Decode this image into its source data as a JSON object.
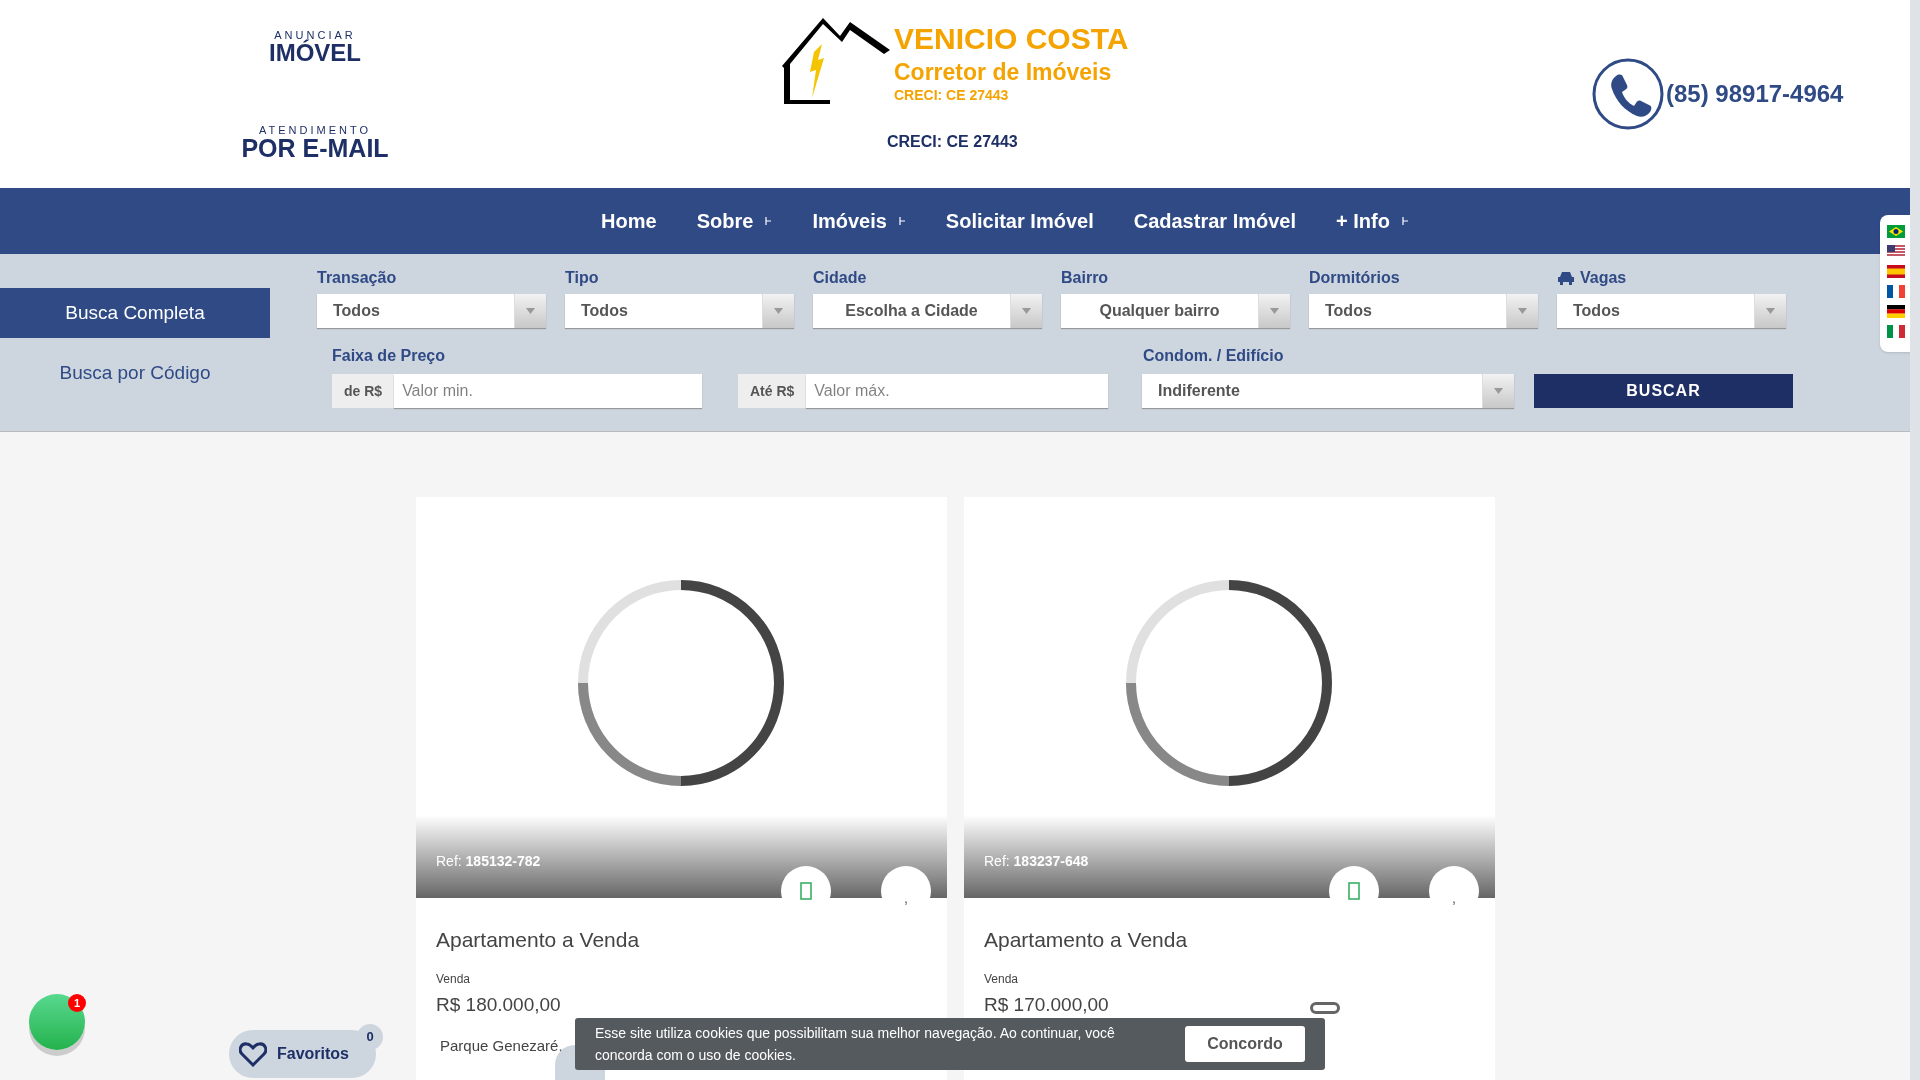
{
  "header": {
    "ad_link": {
      "small": "ANUNCIAR",
      "big": "IMÓVEL"
    },
    "email_link": {
      "small": "ATENDIMENTO",
      "big": "POR E-MAIL"
    },
    "logo": {
      "name": "VENICIO COSTA",
      "tagline": "Corretor de Imóveis",
      "creci": "CRECI: CE 27443"
    },
    "creci": "CRECI: CE 27443",
    "phone": "(85) 98917-4964"
  },
  "nav": [
    {
      "label": "Home",
      "dropdown": false
    },
    {
      "label": "Sobre",
      "dropdown": true
    },
    {
      "label": "Imóveis",
      "dropdown": true
    },
    {
      "label": "Solicitar Imóvel",
      "dropdown": false
    },
    {
      "label": "Cadastrar Imóvel",
      "dropdown": false
    },
    {
      "label": "+ Info",
      "dropdown": true
    }
  ],
  "search_tabs": [
    {
      "label": "Busca Completa",
      "selected": true
    },
    {
      "label": "Busca por Código",
      "selected": false
    }
  ],
  "filters": [
    {
      "label": "Transação",
      "value": "Todos",
      "centered": false,
      "icon": false
    },
    {
      "label": "Tipo",
      "value": "Todos",
      "centered": false,
      "icon": false
    },
    {
      "label": "Cidade",
      "value": "Escolha a Cidade",
      "centered": true,
      "icon": false
    },
    {
      "label": "Bairro",
      "value": "Qualquer bairro",
      "centered": true,
      "icon": false
    },
    {
      "label": "Dormitórios",
      "value": "Todos",
      "centered": false,
      "icon": false
    },
    {
      "label": "Vagas",
      "value": "Todos",
      "centered": false,
      "icon": true
    }
  ],
  "price": {
    "label": "Faixa de Preço",
    "min_prefix": "de R$",
    "min_placeholder": "Valor min.",
    "max_prefix": "Até R$",
    "max_placeholder": "Valor máx."
  },
  "condo": {
    "label": "Condom. / Edifício",
    "value": "Indiferente"
  },
  "search_button": "BUSCAR",
  "listings": [
    {
      "ref_label": "Ref:",
      "ref": "185132-782",
      "title": "Apartamento a Venda",
      "deal": "Venda",
      "price": "R$ 180.000,00",
      "address": "Parque Genezaré,",
      "side_icon": ","
    },
    {
      "ref_label": "Ref:",
      "ref": "183237-648",
      "title": "Apartamento a Venda",
      "deal": "Venda",
      "price": "R$ 170.000,00",
      "side_icon": ","
    }
  ],
  "chat_badge": "1",
  "favorites": {
    "label": "Favoritos",
    "count": "0"
  },
  "cookie": {
    "text": "Esse site utiliza cookies que possibilitam sua melhor navegação. Ao continuar, você concorda com o uso de cookies.",
    "button": "Concordo"
  }
}
